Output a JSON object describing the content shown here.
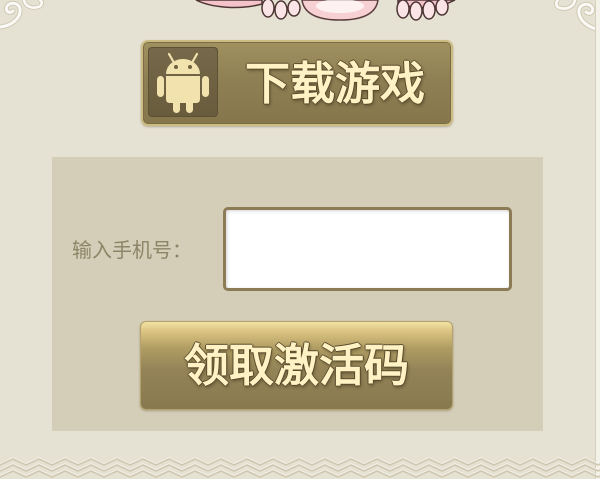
{
  "download": {
    "label": "下载游戏",
    "icon": "android-icon"
  },
  "form": {
    "phone_label": "输入手机号：",
    "phone_value": ""
  },
  "claim": {
    "label": "领取激活码"
  },
  "colors": {
    "page_background": "#e6e2d3",
    "panel_background": "#d4ceb8",
    "button_olive": "#8f8054",
    "button_gold": "#f3e2a3",
    "button_text": "#fff3c6",
    "label_text": "#8e8568",
    "input_border": "#8b7c56"
  }
}
